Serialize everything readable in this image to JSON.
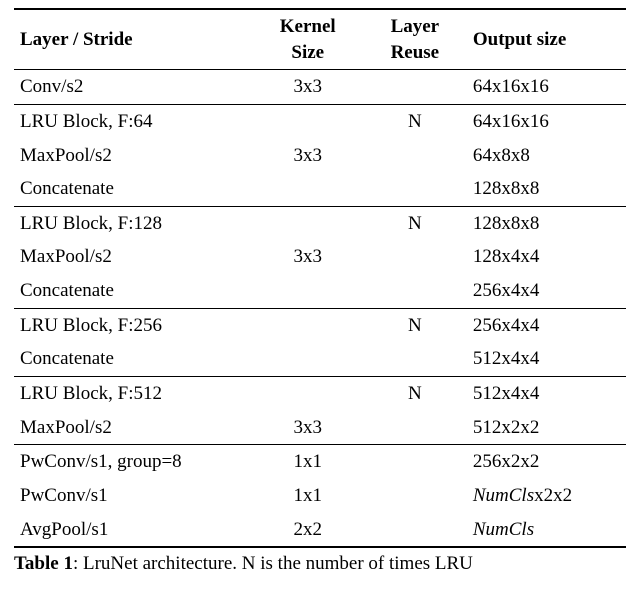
{
  "header": {
    "col1": "Layer / Stride",
    "col2_line1": "Kernel",
    "col2_line2": "Size",
    "col3_line1": "Layer",
    "col3_line2": "Reuse",
    "col4": "Output size"
  },
  "groups": [
    {
      "rows": [
        {
          "name": "Conv/s2",
          "kernel": "3x3",
          "reuse": "",
          "out": "64x16x16"
        }
      ]
    },
    {
      "rows": [
        {
          "name": "LRU Block, F:64",
          "kernel": "",
          "reuse": "N",
          "out": "64x16x16"
        },
        {
          "name": "MaxPool/s2",
          "kernel": "3x3",
          "reuse": "",
          "out": "64x8x8"
        },
        {
          "name": "Concatenate",
          "kernel": "",
          "reuse": "",
          "out": "128x8x8"
        }
      ]
    },
    {
      "rows": [
        {
          "name": "LRU Block, F:128",
          "kernel": "",
          "reuse": "N",
          "out": "128x8x8"
        },
        {
          "name": "MaxPool/s2",
          "kernel": "3x3",
          "reuse": "",
          "out": "128x4x4"
        },
        {
          "name": "Concatenate",
          "kernel": "",
          "reuse": "",
          "out": "256x4x4"
        }
      ]
    },
    {
      "rows": [
        {
          "name": "LRU Block, F:256",
          "kernel": "",
          "reuse": "N",
          "out": "256x4x4"
        },
        {
          "name": "Concatenate",
          "kernel": "",
          "reuse": "",
          "out": "512x4x4"
        }
      ]
    },
    {
      "rows": [
        {
          "name": "LRU Block, F:512",
          "kernel": "",
          "reuse": "N",
          "out": "512x4x4"
        },
        {
          "name": "MaxPool/s2",
          "kernel": "3x3",
          "reuse": "",
          "out": "512x2x2"
        }
      ]
    },
    {
      "rows": [
        {
          "name": "PwConv/s1, group=8",
          "kernel": "1x1",
          "reuse": "",
          "out": "256x2x2"
        },
        {
          "name": "PwConv/s1",
          "kernel": "1x1",
          "reuse": "",
          "out_prefix_ital": "NumCls",
          "out_suffix": "x2x2"
        },
        {
          "name": "AvgPool/s1",
          "kernel": "2x2",
          "reuse": "",
          "out_ital": "NumCls"
        }
      ]
    }
  ],
  "caption": {
    "label": "Table 1",
    "text": ": LruNet architecture. N is the number of times LRU"
  },
  "chart_data": {
    "type": "table",
    "title": "Table 1: LruNet architecture. N is the number of times LRU",
    "columns": [
      "Layer / Stride",
      "Kernel Size",
      "Layer Reuse",
      "Output size"
    ],
    "rows": [
      [
        "Conv/s2",
        "3x3",
        "",
        "64x16x16"
      ],
      [
        "LRU Block, F:64",
        "",
        "N",
        "64x16x16"
      ],
      [
        "MaxPool/s2",
        "3x3",
        "",
        "64x8x8"
      ],
      [
        "Concatenate",
        "",
        "",
        "128x8x8"
      ],
      [
        "LRU Block, F:128",
        "",
        "N",
        "128x8x8"
      ],
      [
        "MaxPool/s2",
        "3x3",
        "",
        "128x4x4"
      ],
      [
        "Concatenate",
        "",
        "",
        "256x4x4"
      ],
      [
        "LRU Block, F:256",
        "",
        "N",
        "256x4x4"
      ],
      [
        "Concatenate",
        "",
        "",
        "512x4x4"
      ],
      [
        "LRU Block, F:512",
        "",
        "N",
        "512x4x4"
      ],
      [
        "MaxPool/s2",
        "3x3",
        "",
        "512x2x2"
      ],
      [
        "PwConv/s1, group=8",
        "1x1",
        "",
        "256x2x2"
      ],
      [
        "PwConv/s1",
        "1x1",
        "",
        "NumClsx2x2"
      ],
      [
        "AvgPool/s1",
        "2x2",
        "",
        "NumCls"
      ]
    ],
    "group_boundaries_after_row_index": [
      0,
      3,
      6,
      8,
      10
    ]
  }
}
